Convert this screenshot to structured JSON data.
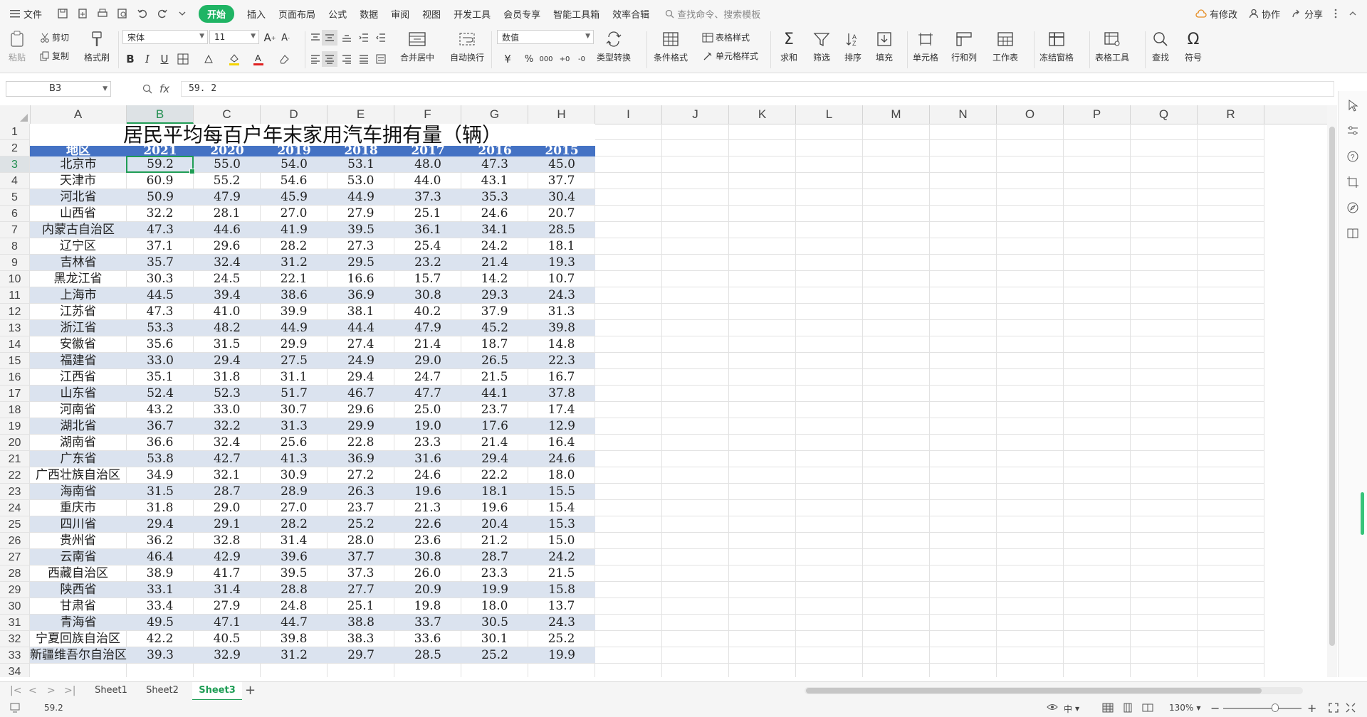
{
  "menubar": {
    "file": "文件",
    "tabs": [
      "开始",
      "插入",
      "页面布局",
      "公式",
      "数据",
      "审阅",
      "视图",
      "开发工具",
      "会员专享",
      "智能工具箱",
      "效率合辑"
    ],
    "active_tab": "开始",
    "search_placeholder": "查找命令、搜索模板",
    "has_changes": "有修改",
    "collaborate": "协作",
    "share": "分享"
  },
  "ribbon": {
    "paste": "粘贴",
    "cut": "剪切",
    "copy": "复制",
    "format_painter": "格式刷",
    "font_name": "宋体",
    "font_size": "11",
    "merge_center": "合并居中",
    "wrap_text": "自动换行",
    "number_format": "数值",
    "type_convert": "类型转换",
    "conditional_format": "条件格式",
    "table_style": "表格样式",
    "cell_style": "单元格样式",
    "sum": "求和",
    "filter": "筛选",
    "sort": "排序",
    "fill": "填充",
    "cell": "单元格",
    "row_col": "行和列",
    "worksheet": "工作表",
    "freeze": "冻结窗格",
    "table_tools": "表格工具",
    "find": "查找",
    "symbol": "符号",
    "percent": "%",
    "thousands": "000"
  },
  "formula_bar": {
    "cell_ref": "B3",
    "fx": "fx",
    "value": "59. 2"
  },
  "columns": [
    "A",
    "B",
    "C",
    "D",
    "E",
    "F",
    "G",
    "H",
    "I",
    "J",
    "K",
    "L",
    "M",
    "N",
    "O",
    "P",
    "Q",
    "R"
  ],
  "selected_col": "B",
  "selected_row": "3",
  "rows": [
    "1",
    "2",
    "3",
    "4",
    "5",
    "6",
    "7",
    "8",
    "9",
    "10",
    "11",
    "12",
    "13",
    "14",
    "15",
    "16",
    "17",
    "18",
    "19",
    "20",
    "21",
    "22",
    "23",
    "24",
    "25",
    "26",
    "27",
    "28",
    "29",
    "30",
    "31",
    "32",
    "33",
    "34"
  ],
  "sheet": {
    "title": "居民平均每百户年末家用汽车拥有量（辆）",
    "header": [
      "地区",
      "2021",
      "2020",
      "2019",
      "2018",
      "2017",
      "2016",
      "2015"
    ],
    "data": [
      [
        "北京市",
        "59.2",
        "55.0",
        "54.0",
        "53.1",
        "48.0",
        "47.3",
        "45.0"
      ],
      [
        "天津市",
        "60.9",
        "55.2",
        "54.6",
        "53.0",
        "44.0",
        "43.1",
        "37.7"
      ],
      [
        "河北省",
        "50.9",
        "47.9",
        "45.9",
        "44.9",
        "37.3",
        "35.3",
        "30.4"
      ],
      [
        "山西省",
        "32.2",
        "28.1",
        "27.0",
        "27.9",
        "25.1",
        "24.6",
        "20.7"
      ],
      [
        "内蒙古自治区",
        "47.3",
        "44.6",
        "41.9",
        "39.5",
        "36.1",
        "34.1",
        "28.5"
      ],
      [
        "辽宁区",
        "37.1",
        "29.6",
        "28.2",
        "27.3",
        "25.4",
        "24.2",
        "18.1"
      ],
      [
        "吉林省",
        "35.7",
        "32.4",
        "31.2",
        "29.5",
        "23.2",
        "21.4",
        "19.3"
      ],
      [
        "黑龙江省",
        "30.3",
        "24.5",
        "22.1",
        "16.6",
        "15.7",
        "14.2",
        "10.7"
      ],
      [
        "上海市",
        "44.5",
        "39.4",
        "38.6",
        "36.9",
        "30.8",
        "29.3",
        "24.3"
      ],
      [
        "江苏省",
        "47.3",
        "41.0",
        "39.9",
        "38.1",
        "40.2",
        "37.9",
        "31.3"
      ],
      [
        "浙江省",
        "53.3",
        "48.2",
        "44.9",
        "44.4",
        "47.9",
        "45.2",
        "39.8"
      ],
      [
        "安徽省",
        "35.6",
        "31.5",
        "29.9",
        "27.4",
        "21.4",
        "18.7",
        "14.8"
      ],
      [
        "福建省",
        "33.0",
        "29.4",
        "27.5",
        "24.9",
        "29.0",
        "26.5",
        "22.3"
      ],
      [
        "江西省",
        "35.1",
        "31.8",
        "31.1",
        "29.4",
        "24.7",
        "21.5",
        "16.7"
      ],
      [
        "山东省",
        "52.4",
        "52.3",
        "51.7",
        "46.7",
        "47.7",
        "44.1",
        "37.8"
      ],
      [
        "河南省",
        "43.2",
        "33.0",
        "30.7",
        "29.6",
        "25.0",
        "23.7",
        "17.4"
      ],
      [
        "湖北省",
        "36.7",
        "32.2",
        "31.3",
        "29.9",
        "19.0",
        "17.6",
        "12.9"
      ],
      [
        "湖南省",
        "36.6",
        "32.4",
        "25.6",
        "22.8",
        "23.3",
        "21.4",
        "16.4"
      ],
      [
        "广东省",
        "53.8",
        "42.7",
        "41.3",
        "36.9",
        "31.6",
        "29.4",
        "24.6"
      ],
      [
        "广西壮族自治区",
        "34.9",
        "32.1",
        "30.9",
        "27.2",
        "24.6",
        "22.2",
        "18.0"
      ],
      [
        "海南省",
        "31.5",
        "28.7",
        "28.9",
        "26.3",
        "19.6",
        "18.1",
        "15.5"
      ],
      [
        "重庆市",
        "31.8",
        "29.0",
        "27.0",
        "23.7",
        "21.3",
        "19.6",
        "15.4"
      ],
      [
        "四川省",
        "29.4",
        "29.1",
        "28.2",
        "25.2",
        "22.6",
        "20.4",
        "15.3"
      ],
      [
        "贵州省",
        "36.2",
        "32.8",
        "31.4",
        "28.0",
        "23.6",
        "21.2",
        "15.0"
      ],
      [
        "云南省",
        "46.4",
        "42.9",
        "39.6",
        "37.7",
        "30.8",
        "28.7",
        "24.2"
      ],
      [
        "西藏自治区",
        "38.9",
        "41.7",
        "39.5",
        "37.3",
        "26.0",
        "23.3",
        "21.5"
      ],
      [
        "陕西省",
        "33.1",
        "31.4",
        "28.8",
        "27.7",
        "20.9",
        "19.9",
        "15.8"
      ],
      [
        "甘肃省",
        "33.4",
        "27.9",
        "24.8",
        "25.1",
        "19.8",
        "18.0",
        "13.7"
      ],
      [
        "青海省",
        "49.5",
        "47.1",
        "44.7",
        "38.8",
        "33.7",
        "30.5",
        "24.3"
      ],
      [
        "宁夏回族自治区",
        "42.2",
        "40.5",
        "39.8",
        "38.3",
        "33.6",
        "30.1",
        "25.2"
      ],
      [
        "新疆维吾尔自治区",
        "39.3",
        "32.9",
        "31.2",
        "29.7",
        "28.5",
        "25.2",
        "19.9"
      ]
    ]
  },
  "sheet_tabs": [
    "Sheet1",
    "Sheet2",
    "Sheet3"
  ],
  "active_sheet": "Sheet3",
  "status": {
    "cell_value": "59.2",
    "zoom": "130%",
    "lang": "中"
  },
  "colors": {
    "accent": "#1fb464",
    "header_fill": "#4472c4",
    "band_fill": "#dbe3ef",
    "select": "#1f9d55"
  }
}
